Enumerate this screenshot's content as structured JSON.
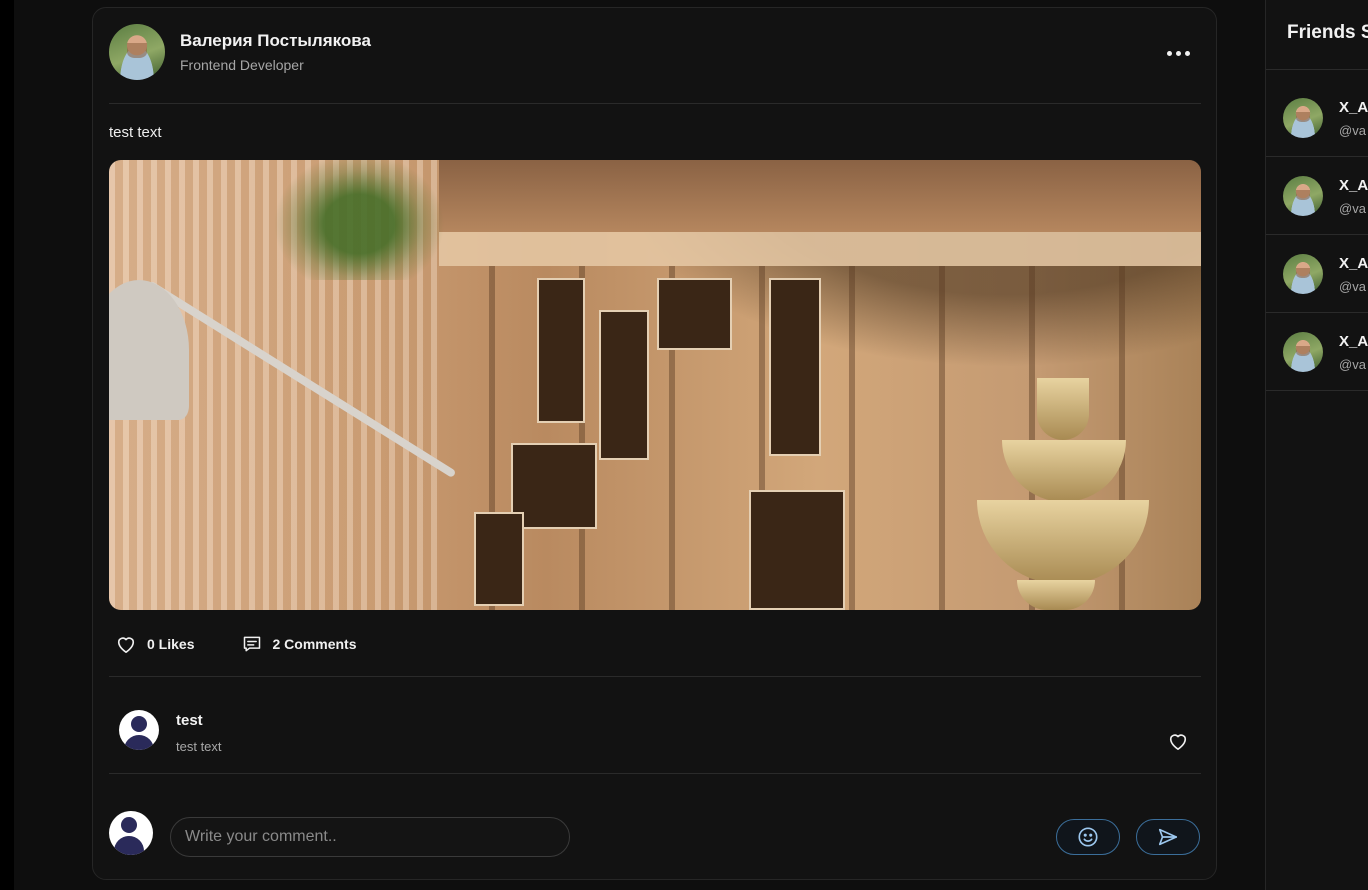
{
  "post": {
    "author_name": "Валерия Постылякова",
    "author_role": "Frontend Developer",
    "text": "test text",
    "likes_label": "0 Likes",
    "comments_label": "2 Comments"
  },
  "comments": [
    {
      "author": "test",
      "text": "test text"
    }
  ],
  "composer": {
    "placeholder": "Write your comment.."
  },
  "friends_panel": {
    "title": "Friends S",
    "items": [
      {
        "name": "X_A",
        "handle": "@va"
      },
      {
        "name": "X_A",
        "handle": "@va"
      },
      {
        "name": "X_A",
        "handle": "@va"
      },
      {
        "name": "X_A",
        "handle": "@va"
      }
    ]
  },
  "colors": {
    "background": "#0e0e0e",
    "card": "#121212",
    "accent_border": "#3b6e9a",
    "text_primary": "#f2f2f2",
    "text_secondary": "#a6a6a6"
  },
  "icons": [
    "more-horizontal-icon",
    "heart-icon",
    "comment-icon",
    "smile-icon",
    "send-icon"
  ]
}
